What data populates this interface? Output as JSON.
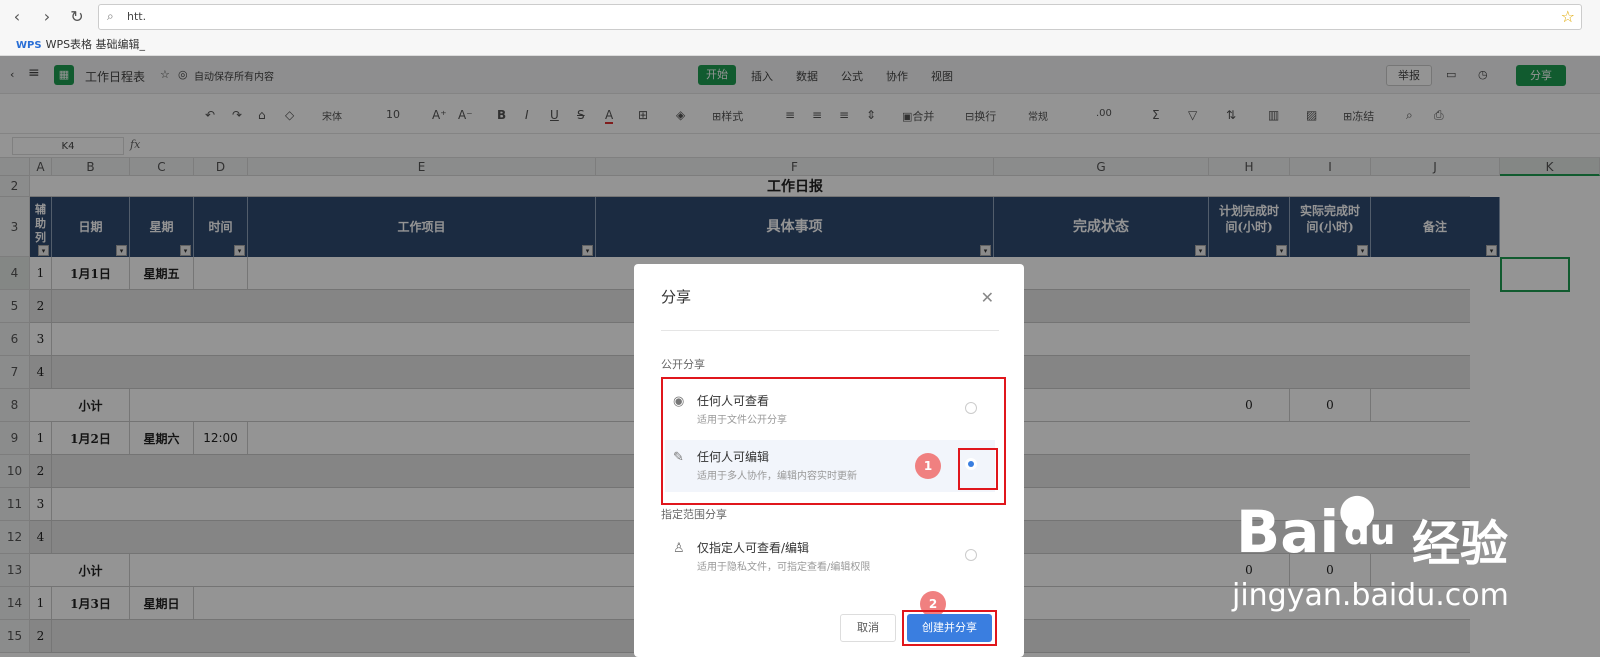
{
  "browser": {
    "url": "htt.",
    "bookmark": "WPS表格 基础编辑_",
    "bookmark_icon": "WPS"
  },
  "app": {
    "doc_title": "工作日程表",
    "autosave": "自动保存所有内容",
    "tabs": [
      "开始",
      "插入",
      "数据",
      "公式",
      "协作",
      "视图"
    ],
    "report": "举报",
    "share": "分享",
    "accent": "#1e9e52"
  },
  "ribbon": {
    "font": "宋体",
    "font_size": "10",
    "style": "样式",
    "merge": "合并",
    "wrap": "换行",
    "format": "常规",
    "freeze": "冻结"
  },
  "formula_bar": {
    "cell_ref": "K4",
    "fx": "fx"
  },
  "sheet": {
    "columns": [
      "A",
      "B",
      "C",
      "D",
      "E",
      "F",
      "G",
      "H",
      "I",
      "J",
      "K"
    ],
    "rows": [
      "2",
      "3",
      "4",
      "5",
      "6",
      "7",
      "8",
      "9",
      "10",
      "11",
      "12",
      "13",
      "14",
      "15"
    ],
    "title": "工作日报",
    "headers": {
      "a": "辅助列",
      "b": "日期",
      "c": "星期",
      "d": "时间",
      "e": "工作项目",
      "f": "具体事项",
      "g": "完成状态",
      "h": "计划完成时间(小时)",
      "i": "实际完成时间(小时)",
      "j": "备注"
    },
    "r4": {
      "a": "1",
      "b": "1月1日",
      "c": "星期五"
    },
    "r5": {
      "a": "2"
    },
    "r6": {
      "a": "3"
    },
    "r7": {
      "a": "4"
    },
    "r8": {
      "b": "小计",
      "h": "0",
      "i": "0"
    },
    "r9": {
      "a": "1",
      "b": "1月2日",
      "c": "星期六",
      "d": "12:00"
    },
    "r10": {
      "a": "2"
    },
    "r11": {
      "a": "3"
    },
    "r12": {
      "a": "4"
    },
    "r13": {
      "b": "小计",
      "h": "0",
      "i": "0"
    },
    "r14": {
      "a": "1",
      "b": "1月3日",
      "c": "星期日"
    },
    "r15": {
      "a": "2"
    }
  },
  "dialog": {
    "title": "分享",
    "public_label": "公开分享",
    "option_view_title": "任何人可查看",
    "option_view_desc": "适用于文件公开分享",
    "option_edit_title": "任何人可编辑",
    "option_edit_desc": "适用于多人协作，编辑内容实时更新",
    "scope_label": "指定范围分享",
    "option_specified_title": "仅指定人可查看/编辑",
    "option_specified_desc": "适用于隐私文件，可指定查看/编辑权限",
    "cancel": "取消",
    "create": "创建并分享",
    "badge1": "1",
    "badge2": "2",
    "selected_option": "任何人可编辑"
  },
  "watermark": {
    "brand_left": "Bai",
    "brand_mid": "du",
    "brand_right": "经验",
    "site": "jingyan.baidu.com"
  }
}
